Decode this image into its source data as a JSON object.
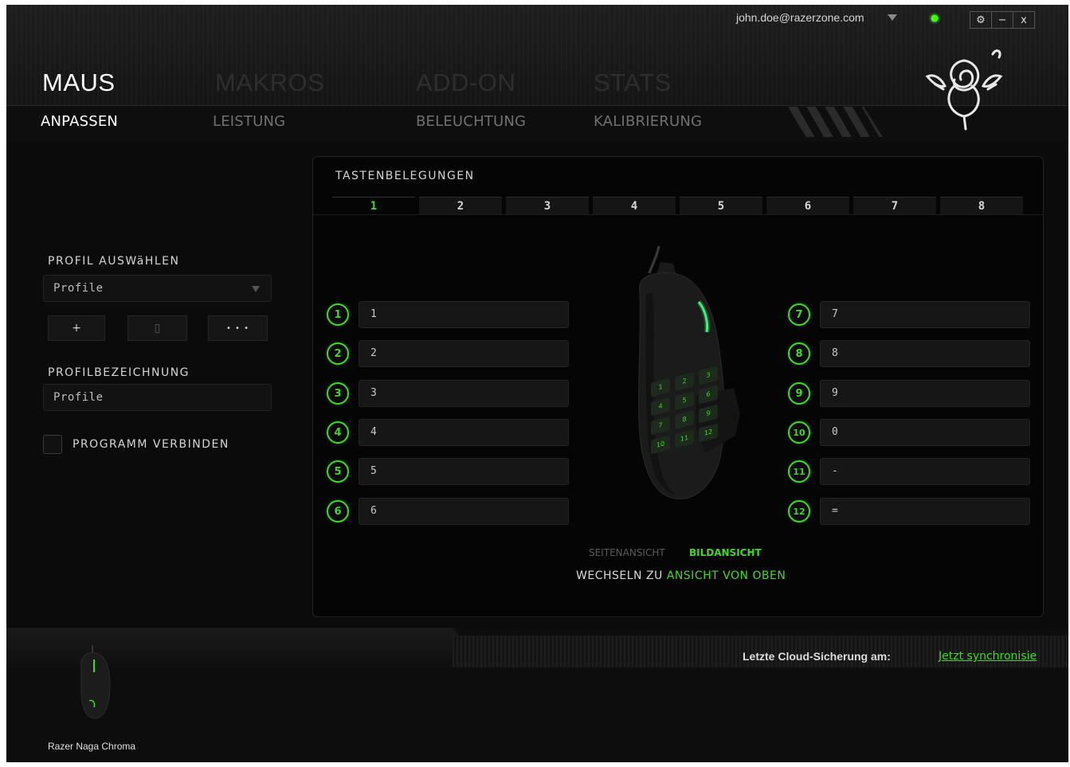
{
  "user": {
    "email": "john.doe@razerzone.com"
  },
  "window_controls": {
    "settings": "⚙",
    "minimize": "−",
    "close": "x"
  },
  "main_nav": [
    "MAUS",
    "MAKROS",
    "ADD-ON",
    "STATS"
  ],
  "sub_nav": [
    "ANPASSEN",
    "LEISTUNG",
    "BELEUCHTUNG",
    "KALIBRIERUNG"
  ],
  "left": {
    "profile_select_label": "PROFIL AUSWäHLEN",
    "profile_selected": "Profile",
    "add_button": "+",
    "delete_button": "▯",
    "more_button": "• • •",
    "profile_name_label": "PROFILBEZEICHNUNG",
    "profile_name_value": "Profile",
    "link_program_label": "PROGRAMM VERBINDEN"
  },
  "panel": {
    "title": "TASTENBELEGUNGEN",
    "tabs": [
      "1",
      "2",
      "3",
      "4",
      "5",
      "6",
      "7",
      "8"
    ],
    "active_tab": "1",
    "keys_left": [
      {
        "num": "1",
        "value": "1"
      },
      {
        "num": "2",
        "value": "2"
      },
      {
        "num": "3",
        "value": "3"
      },
      {
        "num": "4",
        "value": "4"
      },
      {
        "num": "5",
        "value": "5"
      },
      {
        "num": "6",
        "value": "6"
      }
    ],
    "keys_right": [
      {
        "num": "7",
        "value": "7"
      },
      {
        "num": "8",
        "value": "8"
      },
      {
        "num": "9",
        "value": "9"
      },
      {
        "num": "10",
        "value": "0"
      },
      {
        "num": "11",
        "value": "-"
      },
      {
        "num": "12",
        "value": "="
      }
    ],
    "side_keypad_labels": [
      "1",
      "2",
      "3",
      "4",
      "5",
      "6",
      "7",
      "8",
      "9",
      "10",
      "11",
      "12"
    ],
    "view_side": "SEITENANSICHT",
    "view_image": "BILDANSICHT",
    "switch_prefix": "WECHSELN ZU",
    "switch_link": "ANSICHT VON OBEN"
  },
  "footer": {
    "cloud_label": "Letzte Cloud-Sicherung am:",
    "sync_link": "Jetzt synchronisie",
    "device_name": "Razer Naga Chroma"
  },
  "colors": {
    "accent": "#44d62c",
    "background": "#0b0b0b"
  }
}
